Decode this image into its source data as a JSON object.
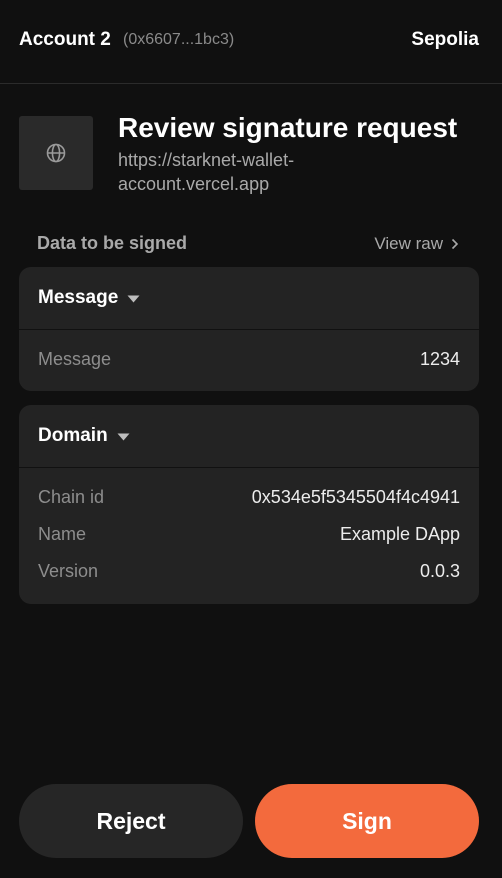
{
  "header": {
    "account_name": "Account 2",
    "account_address": "(0x6607...1bc3)",
    "network": "Sepolia"
  },
  "request": {
    "title": "Review signature request",
    "origin": "https://starknet-wallet-account.vercel.app",
    "site_icon": "globe-icon"
  },
  "data_section": {
    "label": "Data to be signed",
    "view_raw_label": "View raw"
  },
  "message_card": {
    "title": "Message",
    "rows": [
      {
        "key": "Message",
        "value": "1234"
      }
    ]
  },
  "domain_card": {
    "title": "Domain",
    "rows": [
      {
        "key": "Chain id",
        "value": "0x534e5f5345504f4c4941"
      },
      {
        "key": "Name",
        "value": "Example DApp"
      },
      {
        "key": "Version",
        "value": "0.0.3"
      }
    ]
  },
  "actions": {
    "reject_label": "Reject",
    "sign_label": "Sign"
  },
  "colors": {
    "background": "#101010",
    "card": "#232323",
    "accent": "#f36a3d"
  }
}
